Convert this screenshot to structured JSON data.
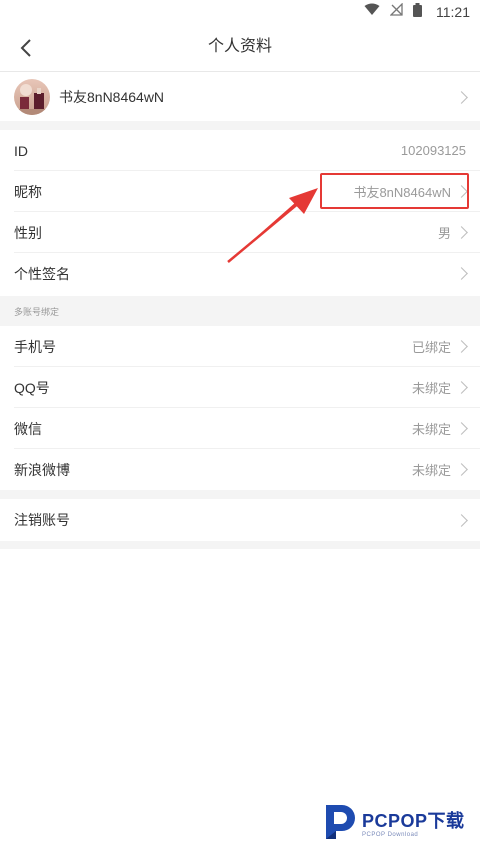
{
  "status_bar": {
    "time": "11:21"
  },
  "nav": {
    "title": "个人资料"
  },
  "profile": {
    "name": "书友8nN8464wN"
  },
  "rows": [
    {
      "label": "ID",
      "value": "102093125"
    },
    {
      "label": "昵称",
      "value": "书友8nN8464wN"
    },
    {
      "label": "性别",
      "value": "男"
    },
    {
      "label": "个性签名",
      "value": ""
    }
  ],
  "section_header": "多账号绑定",
  "binding_rows": [
    {
      "label": "手机号",
      "value": "已绑定"
    },
    {
      "label": "QQ号",
      "value": "未绑定"
    },
    {
      "label": "微信",
      "value": "未绑定"
    },
    {
      "label": "新浪微博",
      "value": "未绑定"
    }
  ],
  "cancel_account": {
    "label": "注销账号"
  },
  "watermark": {
    "brand": "PCPOP下载",
    "sub": "PCPOP Download"
  },
  "colors": {
    "highlight": "#e53935",
    "brand": "#1a3a9a",
    "chevron": "#bdbdbd",
    "gap": "#f4f4f4"
  }
}
